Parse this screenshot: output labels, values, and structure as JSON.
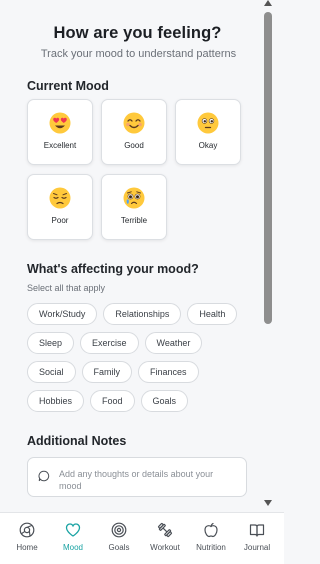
{
  "header": {
    "title": "How are you feeling?",
    "subtitle": "Track your mood to understand patterns"
  },
  "current_mood": {
    "title": "Current Mood",
    "options": [
      {
        "label": "Excellent",
        "icon": "heart-eyes-emoji"
      },
      {
        "label": "Good",
        "icon": "smiling-emoji"
      },
      {
        "label": "Okay",
        "icon": "neutral-emoji"
      },
      {
        "label": "Poor",
        "icon": "pensive-emoji"
      },
      {
        "label": "Terrible",
        "icon": "crying-emoji"
      }
    ]
  },
  "factors": {
    "title": "What's affecting your mood?",
    "helper": "Select all that apply",
    "chips": [
      "Work/Study",
      "Relationships",
      "Health",
      "Sleep",
      "Exercise",
      "Weather",
      "Social",
      "Family",
      "Finances",
      "Hobbies",
      "Food",
      "Goals"
    ]
  },
  "notes": {
    "title": "Additional Notes",
    "placeholder": "Add any thoughts or details about your mood"
  },
  "tabs": [
    {
      "label": "Home",
      "icon": "home-icon",
      "active": false
    },
    {
      "label": "Mood",
      "icon": "heart-icon",
      "active": true
    },
    {
      "label": "Goals",
      "icon": "target-icon",
      "active": false
    },
    {
      "label": "Workout",
      "icon": "dumbbell-icon",
      "active": false
    },
    {
      "label": "Nutrition",
      "icon": "apple-icon",
      "active": false
    },
    {
      "label": "Journal",
      "icon": "book-icon",
      "active": false
    }
  ],
  "colors": {
    "accent": "#1aa3a3",
    "emoji_face": "#ffc93c"
  }
}
